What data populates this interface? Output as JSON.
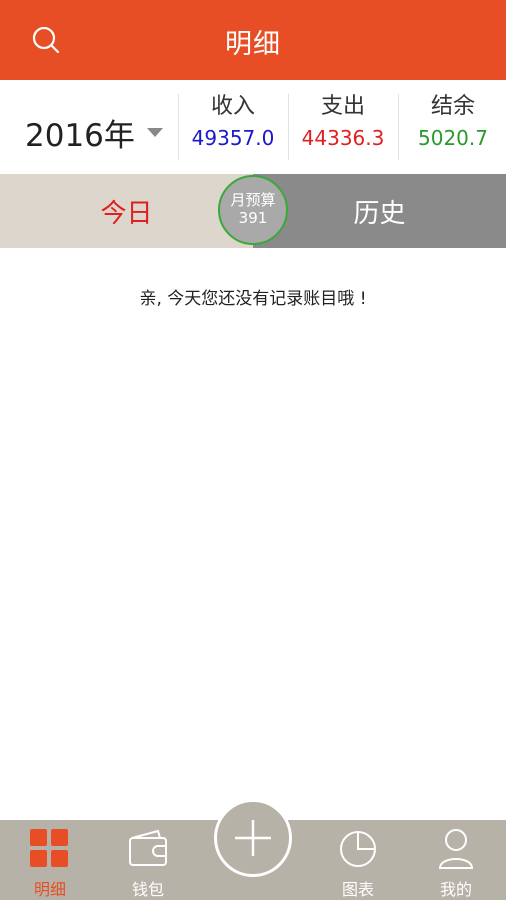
{
  "header": {
    "title": "明细",
    "search_icon": "search-icon"
  },
  "summary": {
    "year": "2016年",
    "income_label": "收入",
    "income_value": "49357.0",
    "expense_label": "支出",
    "expense_value": "44336.3",
    "balance_label": "结余",
    "balance_value": "5020.7",
    "colors": {
      "income": "#1a1ac8",
      "expense": "#e02020",
      "balance": "#2a9a2a"
    }
  },
  "tabs": {
    "today": "今日",
    "history": "历史"
  },
  "budget": {
    "label": "月预算",
    "value": "391"
  },
  "empty_message": "亲, 今天您还没有记录账目哦 !",
  "bottom_nav": {
    "items": [
      {
        "label": "明细",
        "icon": "grid-icon",
        "active": true
      },
      {
        "label": "钱包",
        "icon": "wallet-icon",
        "active": false
      },
      {
        "label": "图表",
        "icon": "pie-chart-icon",
        "active": false
      },
      {
        "label": "我的",
        "icon": "user-icon",
        "active": false
      }
    ],
    "add_icon": "plus-icon"
  },
  "brand_color": "#e84e25"
}
